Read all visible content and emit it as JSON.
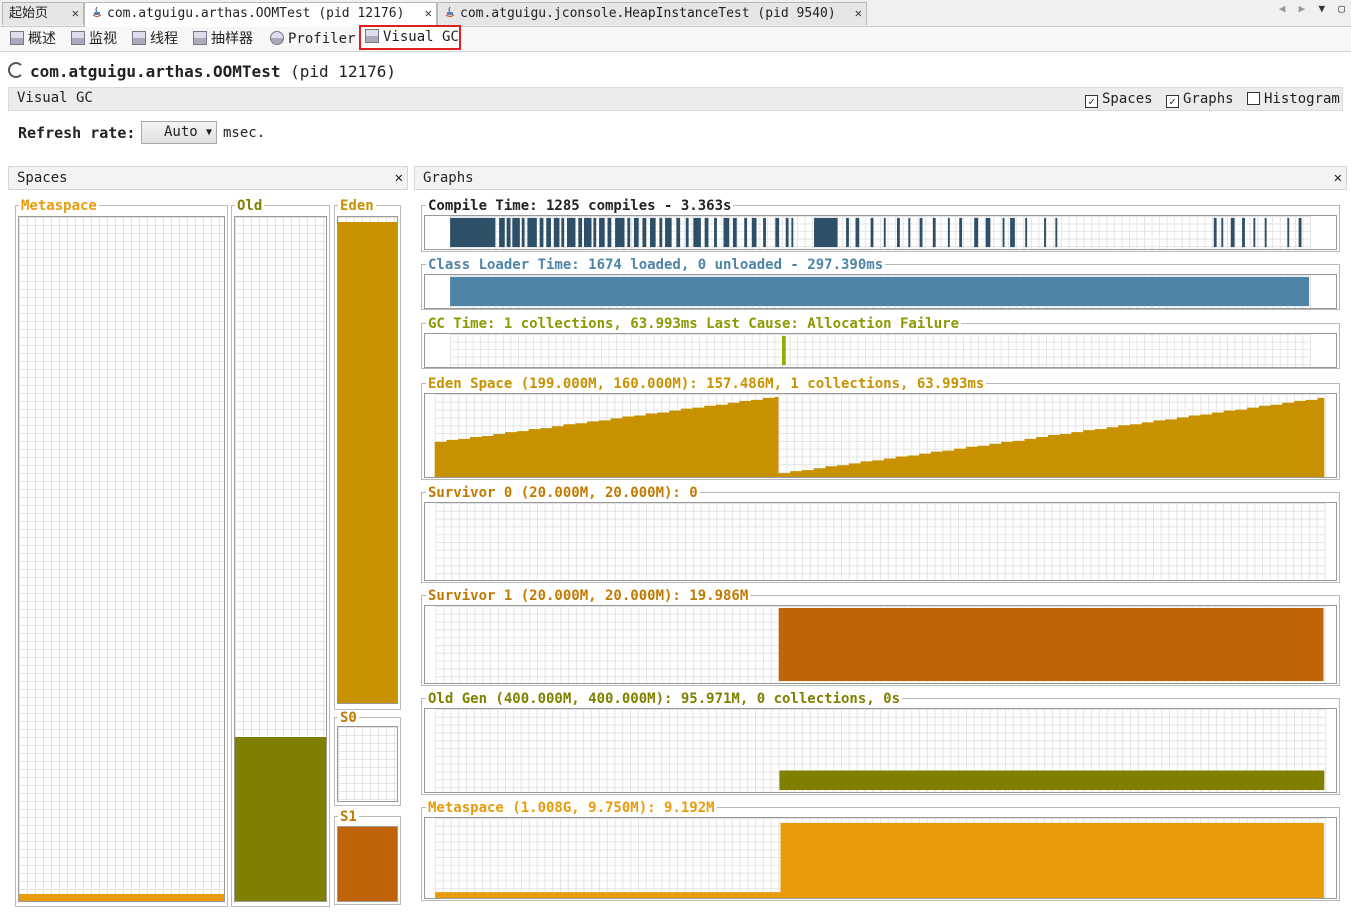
{
  "tabs": [
    {
      "label": "起始页",
      "active": false
    },
    {
      "label": "com.atguigu.arthas.OOMTest (pid 12176)",
      "active": true
    },
    {
      "label": "com.atguigu.jconsole.HeapInstanceTest (pid 9540)",
      "active": false
    }
  ],
  "subtabs": [
    {
      "label": "概述",
      "icon": "overview-icon"
    },
    {
      "label": "监视",
      "icon": "monitor-icon"
    },
    {
      "label": "线程",
      "icon": "threads-icon"
    },
    {
      "label": "抽样器",
      "icon": "sampler-icon"
    },
    {
      "label": "Profiler",
      "icon": "profiler-icon"
    },
    {
      "label": "Visual GC",
      "icon": "visual-gc-icon",
      "highlighted": true
    }
  ],
  "app": {
    "name": "com.atguigu.arthas.OOMTest",
    "pid": "(pid 12176)"
  },
  "visual_gc": {
    "label": "Visual GC",
    "options": [
      {
        "label": "Spaces",
        "checked": true
      },
      {
        "label": "Graphs",
        "checked": true
      },
      {
        "label": "Histogram",
        "checked": false
      }
    ],
    "refresh_label": "Refresh rate:",
    "refresh_value": "Auto",
    "refresh_unit": "msec."
  },
  "spaces_panel": {
    "title": "Spaces",
    "spaces": [
      {
        "label": "Metaspace",
        "fill": 0.01,
        "color": "#E89B0B"
      },
      {
        "label": "Old",
        "fill": 0.24,
        "color": "#808000"
      },
      {
        "label": "Eden",
        "fill": 0.99,
        "color": "#C89100"
      },
      {
        "label": "S0",
        "fill": 0.0,
        "color": "#C0640A"
      },
      {
        "label": "S1",
        "fill": 0.999,
        "color": "#C0640A"
      }
    ]
  },
  "graphs_panel": {
    "title": "Graphs",
    "graphs": [
      {
        "label": "Compile Time: 1285 compiles - 3.363s",
        "color": "#2D5068",
        "label_color": "#222"
      },
      {
        "label": "Class Loader Time: 1674 loaded, 0 unloaded - 297.390ms",
        "color": "#4E84A6",
        "label_color": "#4E84A6"
      },
      {
        "label": "GC Time: 1 collections, 63.993ms Last Cause: Allocation Failure",
        "color": "#9AAA00",
        "label_color": "#8A9A00"
      },
      {
        "label": "Eden Space (199.000M, 160.000M): 157.486M, 1 collections, 63.993ms",
        "color": "#C89100",
        "label_color": "#C89100"
      },
      {
        "label": "Survivor 0 (20.000M, 20.000M): 0",
        "color": "#C0640A",
        "label_color": "#C07A00"
      },
      {
        "label": "Survivor 1 (20.000M, 20.000M): 19.986M",
        "color": "#C0640A",
        "label_color": "#C07A00"
      },
      {
        "label": "Old Gen (400.000M, 400.000M): 95.971M, 0 collections, 0s",
        "color": "#808000",
        "label_color": "#808000"
      },
      {
        "label": "Metaspace (1.008G, 9.750M): 9.192M",
        "color": "#E89B0B",
        "label_color": "#E89B0B"
      }
    ]
  }
}
